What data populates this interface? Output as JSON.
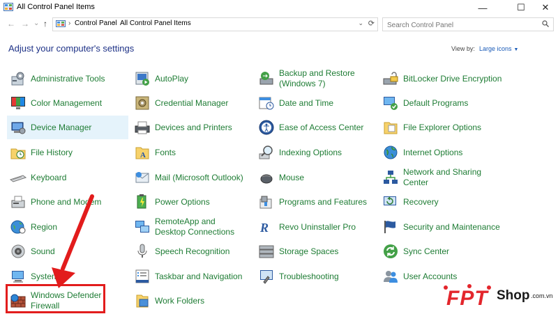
{
  "window": {
    "title": "All Control Panel Items",
    "controls": {
      "minimize": "—",
      "maximize": "☐",
      "close": "✕"
    }
  },
  "nav": {
    "back": "←",
    "forward": "→",
    "dropdown": "⌄",
    "up": "↑",
    "breadcrumbs": [
      "Control Panel",
      "All Control Panel Items"
    ],
    "separator": "›",
    "search_placeholder": "Search Control Panel"
  },
  "header": {
    "title": "Adjust your computer's settings",
    "view_by_label": "View by:",
    "view_by_value": "Large icons"
  },
  "items": [
    {
      "id": "administrative-tools",
      "label": "Administrative Tools",
      "icon": "tools-icon"
    },
    {
      "id": "color-management",
      "label": "Color Management",
      "icon": "monitor-color-icon"
    },
    {
      "id": "device-manager",
      "label": "Device Manager",
      "icon": "device-manager-icon"
    },
    {
      "id": "file-history",
      "label": "File History",
      "icon": "folder-clock-icon"
    },
    {
      "id": "keyboard",
      "label": "Keyboard",
      "icon": "keyboard-icon"
    },
    {
      "id": "phone-and-modem",
      "label": "Phone and Modem",
      "icon": "fax-icon"
    },
    {
      "id": "region",
      "label": "Region",
      "icon": "globe-clock-icon"
    },
    {
      "id": "sound",
      "label": "Sound",
      "icon": "speaker-icon"
    },
    {
      "id": "system",
      "label": "System",
      "icon": "computer-icon"
    },
    {
      "id": "windows-defender-firewall",
      "label": "Windows Defender Firewall",
      "icon": "firewall-icon"
    },
    {
      "id": "autoplay",
      "label": "AutoPlay",
      "icon": "autoplay-icon"
    },
    {
      "id": "credential-manager",
      "label": "Credential Manager",
      "icon": "vault-icon"
    },
    {
      "id": "devices-and-printers",
      "label": "Devices and Printers",
      "icon": "printer-icon"
    },
    {
      "id": "fonts",
      "label": "Fonts",
      "icon": "fonts-folder-icon"
    },
    {
      "id": "mail",
      "label": "Mail (Microsoft Outlook)",
      "icon": "mail-icon"
    },
    {
      "id": "power-options",
      "label": "Power Options",
      "icon": "battery-icon"
    },
    {
      "id": "remoteapp",
      "label": "RemoteApp and Desktop Connections",
      "icon": "remote-desktop-icon"
    },
    {
      "id": "speech-recognition",
      "label": "Speech Recognition",
      "icon": "microphone-icon"
    },
    {
      "id": "taskbar-and-navigation",
      "label": "Taskbar and Navigation",
      "icon": "taskbar-icon"
    },
    {
      "id": "work-folders",
      "label": "Work Folders",
      "icon": "work-folders-icon"
    },
    {
      "id": "backup-and-restore",
      "label": "Backup and Restore (Windows 7)",
      "icon": "backup-icon"
    },
    {
      "id": "date-and-time",
      "label": "Date and Time",
      "icon": "calendar-clock-icon"
    },
    {
      "id": "ease-of-access-center",
      "label": "Ease of Access Center",
      "icon": "accessibility-icon"
    },
    {
      "id": "indexing-options",
      "label": "Indexing Options",
      "icon": "magnifier-icon"
    },
    {
      "id": "mouse",
      "label": "Mouse",
      "icon": "mouse-icon"
    },
    {
      "id": "programs-and-features",
      "label": "Programs and Features",
      "icon": "programs-icon"
    },
    {
      "id": "revo-uninstaller-pro",
      "label": "Revo Uninstaller Pro",
      "icon": "revo-icon"
    },
    {
      "id": "storage-spaces",
      "label": "Storage Spaces",
      "icon": "storage-icon"
    },
    {
      "id": "troubleshooting",
      "label": "Troubleshooting",
      "icon": "troubleshoot-icon"
    },
    {
      "id": "bitlocker",
      "label": "BitLocker Drive Encryption",
      "icon": "bitlocker-icon"
    },
    {
      "id": "default-programs",
      "label": "Default Programs",
      "icon": "default-programs-icon"
    },
    {
      "id": "file-explorer-options",
      "label": "File Explorer Options",
      "icon": "folder-options-icon"
    },
    {
      "id": "internet-options",
      "label": "Internet Options",
      "icon": "internet-icon"
    },
    {
      "id": "network-and-sharing-center",
      "label": "Network and Sharing Center",
      "icon": "network-icon"
    },
    {
      "id": "recovery",
      "label": "Recovery",
      "icon": "recovery-icon"
    },
    {
      "id": "security-and-maintenance",
      "label": "Security and Maintenance",
      "icon": "flag-icon"
    },
    {
      "id": "sync-center",
      "label": "Sync Center",
      "icon": "sync-icon"
    },
    {
      "id": "user-accounts",
      "label": "User Accounts",
      "icon": "users-icon"
    }
  ],
  "brand": {
    "name": "FPT",
    "shop": "Shop",
    "domain": ".com.vn"
  },
  "colors": {
    "link_green": "#1e7c34",
    "heading_blue": "#1e3287",
    "highlight_red": "#e21c1c"
  }
}
